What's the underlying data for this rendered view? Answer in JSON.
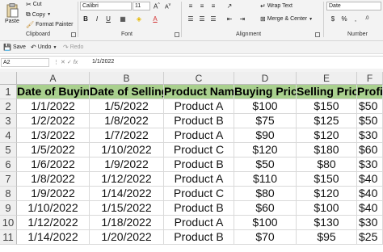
{
  "ribbon": {
    "clipboard": {
      "paste": "Paste",
      "cut": "Cut",
      "copy": "Copy",
      "format_painter": "Format Painter",
      "label": "Clipboard"
    },
    "font": {
      "name": "Calibri",
      "size": "11",
      "label": "Font"
    },
    "alignment": {
      "wrap_text": "Wrap Text",
      "merge_center": "Merge & Center",
      "label": "Alignment"
    },
    "number": {
      "format": "Date",
      "label": "Number"
    }
  },
  "quick_access": {
    "save": "Save",
    "undo": "Undo",
    "redo": "Redo"
  },
  "formula_bar": {
    "name_box": "A2",
    "fx": "fx",
    "value": "1/1/2022"
  },
  "sheet": {
    "columns": [
      "A",
      "B",
      "C",
      "D",
      "E",
      "F"
    ],
    "row_numbers": [
      "1",
      "2",
      "3",
      "4",
      "5",
      "6",
      "7",
      "8",
      "9",
      "10",
      "11"
    ],
    "headers": [
      "Date of Buying",
      "Date of Selling",
      "Product Name",
      "Buying Price",
      "Selling Price",
      "Profit"
    ],
    "rows": [
      [
        "1/1/2022",
        "1/5/2022",
        "Product A",
        "$100",
        "$150",
        "$50"
      ],
      [
        "1/2/2022",
        "1/8/2022",
        "Product B",
        "$75",
        "$125",
        "$50"
      ],
      [
        "1/3/2022",
        "1/7/2022",
        "Product A",
        "$90",
        "$120",
        "$30"
      ],
      [
        "1/5/2022",
        "1/10/2022",
        "Product C",
        "$120",
        "$180",
        "$60"
      ],
      [
        "1/6/2022",
        "1/9/2022",
        "Product B",
        "$50",
        "$80",
        "$30"
      ],
      [
        "1/8/2022",
        "1/12/2022",
        "Product A",
        "$110",
        "$150",
        "$40"
      ],
      [
        "1/9/2022",
        "1/14/2022",
        "Product C",
        "$80",
        "$120",
        "$40"
      ],
      [
        "1/10/2022",
        "1/15/2022",
        "Product B",
        "$60",
        "$100",
        "$40"
      ],
      [
        "1/12/2022",
        "1/18/2022",
        "Product A",
        "$100",
        "$130",
        "$30"
      ],
      [
        "1/14/2022",
        "1/20/2022",
        "Product B",
        "$70",
        "$95",
        "$25"
      ]
    ]
  },
  "colors": {
    "header_fill": "#a9d08e",
    "ribbon_bg": "#f3f3f3",
    "underline_red": "#d32f2f"
  }
}
